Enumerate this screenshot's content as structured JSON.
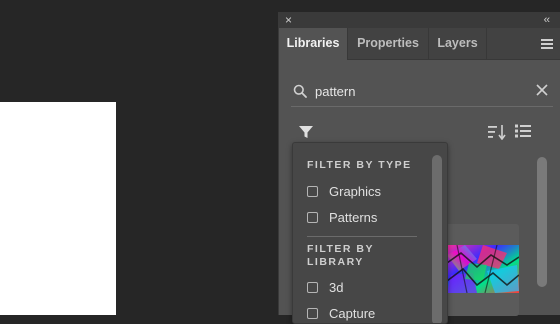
{
  "panel": {
    "close_glyph": "×",
    "collapse_glyph": "‹‹"
  },
  "tabs": [
    {
      "label": "Libraries",
      "active": true
    },
    {
      "label": "Properties",
      "active": false
    },
    {
      "label": "Layers",
      "active": false
    }
  ],
  "search": {
    "value": "pattern",
    "placeholder": ""
  },
  "filter_menu": {
    "by_type_heading": "FILTER BY TYPE",
    "type_options": [
      {
        "label": "Graphics",
        "checked": false
      },
      {
        "label": "Patterns",
        "checked": false
      }
    ],
    "by_library_heading_line1": "FILTER BY",
    "by_library_heading_line2": "LIBRARY",
    "library_options": [
      {
        "label": "3d",
        "checked": false
      },
      {
        "label": "Capture",
        "checked": false
      }
    ]
  },
  "icons": {
    "close": "close-icon",
    "collapse": "collapse-icon",
    "menu": "hamburger-menu-icon",
    "search": "search-icon",
    "clear": "clear-icon",
    "filter": "filter-icon",
    "sort": "sort-icon",
    "view": "list-view-icon"
  },
  "colors": {
    "panel_bg": "#535353",
    "app_bg": "#262626",
    "canvas": "#ffffff",
    "dropdown_bg": "#474747"
  }
}
